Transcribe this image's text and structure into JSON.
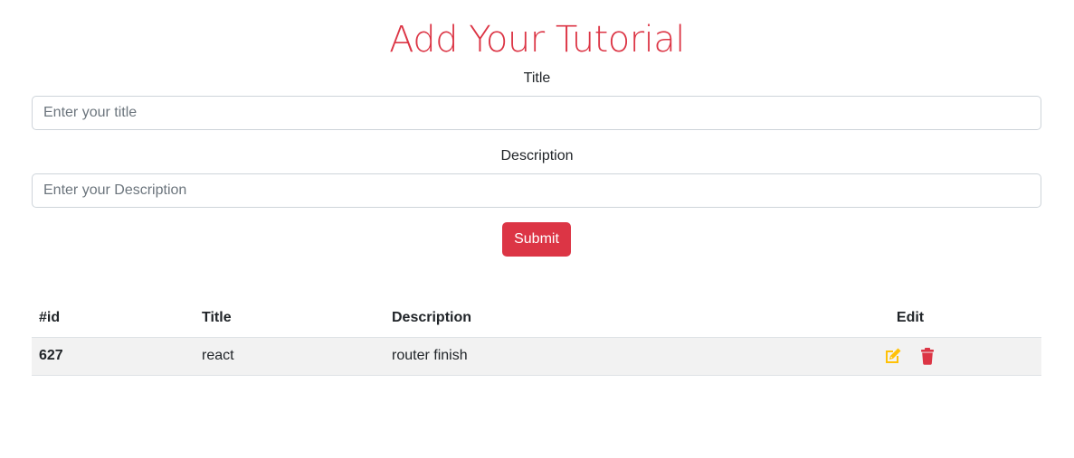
{
  "form": {
    "heading": "Add Your Tutorial",
    "title_label": "Title",
    "title_placeholder": "Enter your title",
    "description_label": "Description",
    "description_placeholder": "Enter your Description",
    "submit_label": "Submit"
  },
  "table": {
    "headers": [
      "#id",
      "Title",
      "Description",
      "Edit"
    ],
    "rows": [
      {
        "id": "627",
        "title": "react",
        "description": "router finish"
      }
    ]
  },
  "colors": {
    "accent": "#dc3545",
    "edit_icon": "#ffc107",
    "delete_icon": "#dc3545"
  },
  "icons": {
    "edit": "edit-icon",
    "delete": "trash-icon"
  }
}
